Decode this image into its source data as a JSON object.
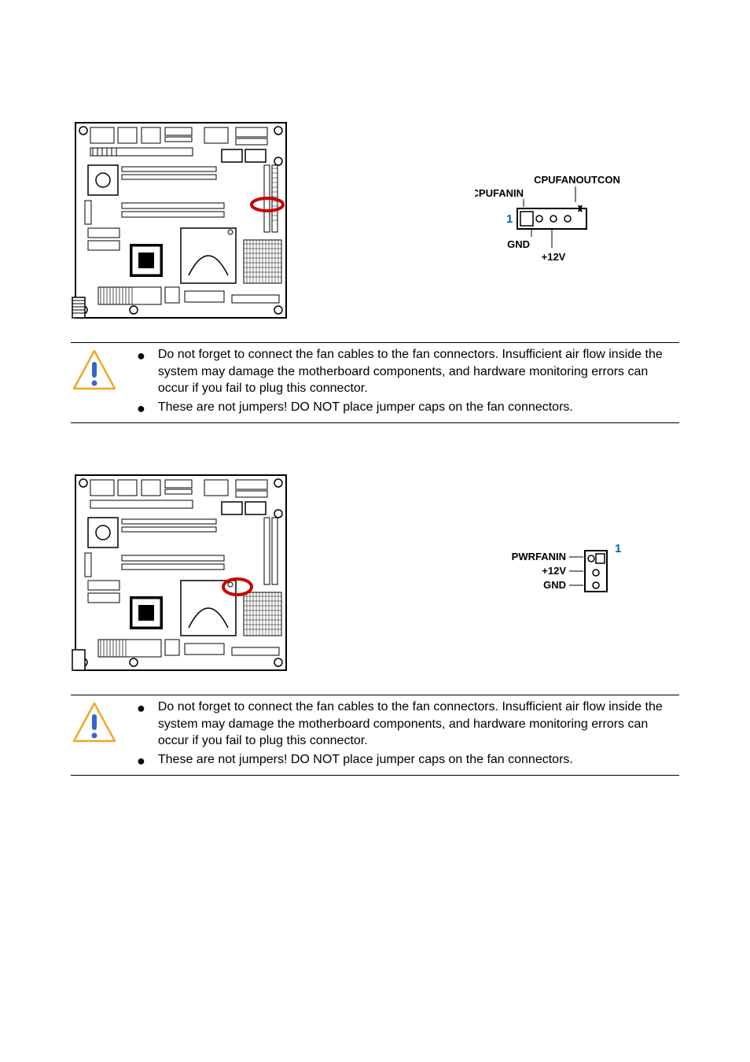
{
  "cpu_fan": {
    "labels": {
      "top": "CPUFANOUTCON",
      "left": "CPUFANIN",
      "pin1": "1",
      "gnd": "GND",
      "v12": "+12V"
    }
  },
  "pwr_fan": {
    "labels": {
      "pwrfanin": "PWRFANIN",
      "v12": "+12V",
      "gnd": "GND",
      "pin1": "1"
    }
  },
  "callout": {
    "bullet1": "Do not forget to connect the fan cables to the fan connectors. Insufficient air flow inside the system may damage the motherboard components, and hardware monitoring errors can occur if you fail to plug this connector.",
    "bullet2": "These are not jumpers! DO NOT place jumper caps on the fan connectors."
  }
}
